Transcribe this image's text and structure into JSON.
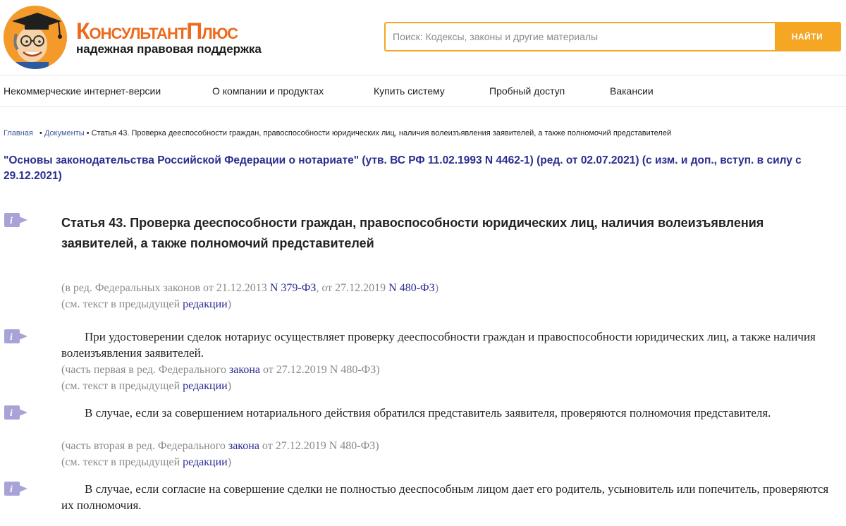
{
  "header": {
    "brand_name": "КонсультантПлюс",
    "brand_tagline": "надежная правовая поддержка",
    "search_placeholder": "Поиск: Кодексы, законы и другие материалы",
    "search_button": "НАЙТИ",
    "brand_color": "#ec6a1c",
    "accent_color": "#f5a623"
  },
  "nav": {
    "items": [
      {
        "label": "Некоммерческие интернет-версии"
      },
      {
        "label": "О компании и продуктах"
      },
      {
        "label": "Купить систему"
      },
      {
        "label": "Пробный доступ"
      },
      {
        "label": "Вакансии"
      }
    ]
  },
  "breadcrumb": {
    "home": "Главная",
    "documents": "Документы",
    "current": "Статья 43. Проверка дееспособности граждан, правоспособности юридических лиц, наличия волеизъявления заявителей, а также полномочий представителей"
  },
  "document": {
    "title": "\"Основы законодательства Российской Федерации о нотариате\" (утв. ВС РФ 11.02.1993 N 4462-1) (ред. от 02.07.2021) (с изм. и доп., вступ. в силу с 29.12.2021)",
    "article_title": "Статья 43. Проверка дееспособности граждан, правоспособности юридических лиц, наличия волеизъявления заявителей, а также полномочий представителей",
    "amend_note": {
      "prefix": "(в ред. Федеральных законов от 21.12.2013 ",
      "link1": "N 379-ФЗ",
      "middle": ", от 27.12.2019 ",
      "link2": "N 480-ФЗ",
      "suffix": ")"
    },
    "see_prefix": "(см. текст в предыдущей ",
    "see_link": "редакции",
    "see_suffix": ")",
    "paragraphs": [
      {
        "text": "При удостоверении сделок нотариус осуществляет проверку дееспособности граждан и правоспособности юридических лиц, а также наличия волеизъявления заявителей.",
        "note_prefix": "(часть первая в ред. Федерального ",
        "note_link": "закона",
        "note_suffix": " от 27.12.2019 N 480-ФЗ)"
      },
      {
        "text": "В случае, если за совершением нотариального действия обратился представитель заявителя, проверяются полномочия представителя.",
        "note_prefix": "(часть вторая в ред. Федерального ",
        "note_link": "закона",
        "note_suffix": " от 27.12.2019 N 480-ФЗ)"
      },
      {
        "text": "В случае, если согласие на совершение сделки не полностью дееспособным лицом дает его родитель, усыновитель или попечитель, проверяются их полномочия."
      }
    ]
  },
  "icons": {
    "info_icon": "info-icon",
    "logo": "professor-mascot-logo"
  }
}
